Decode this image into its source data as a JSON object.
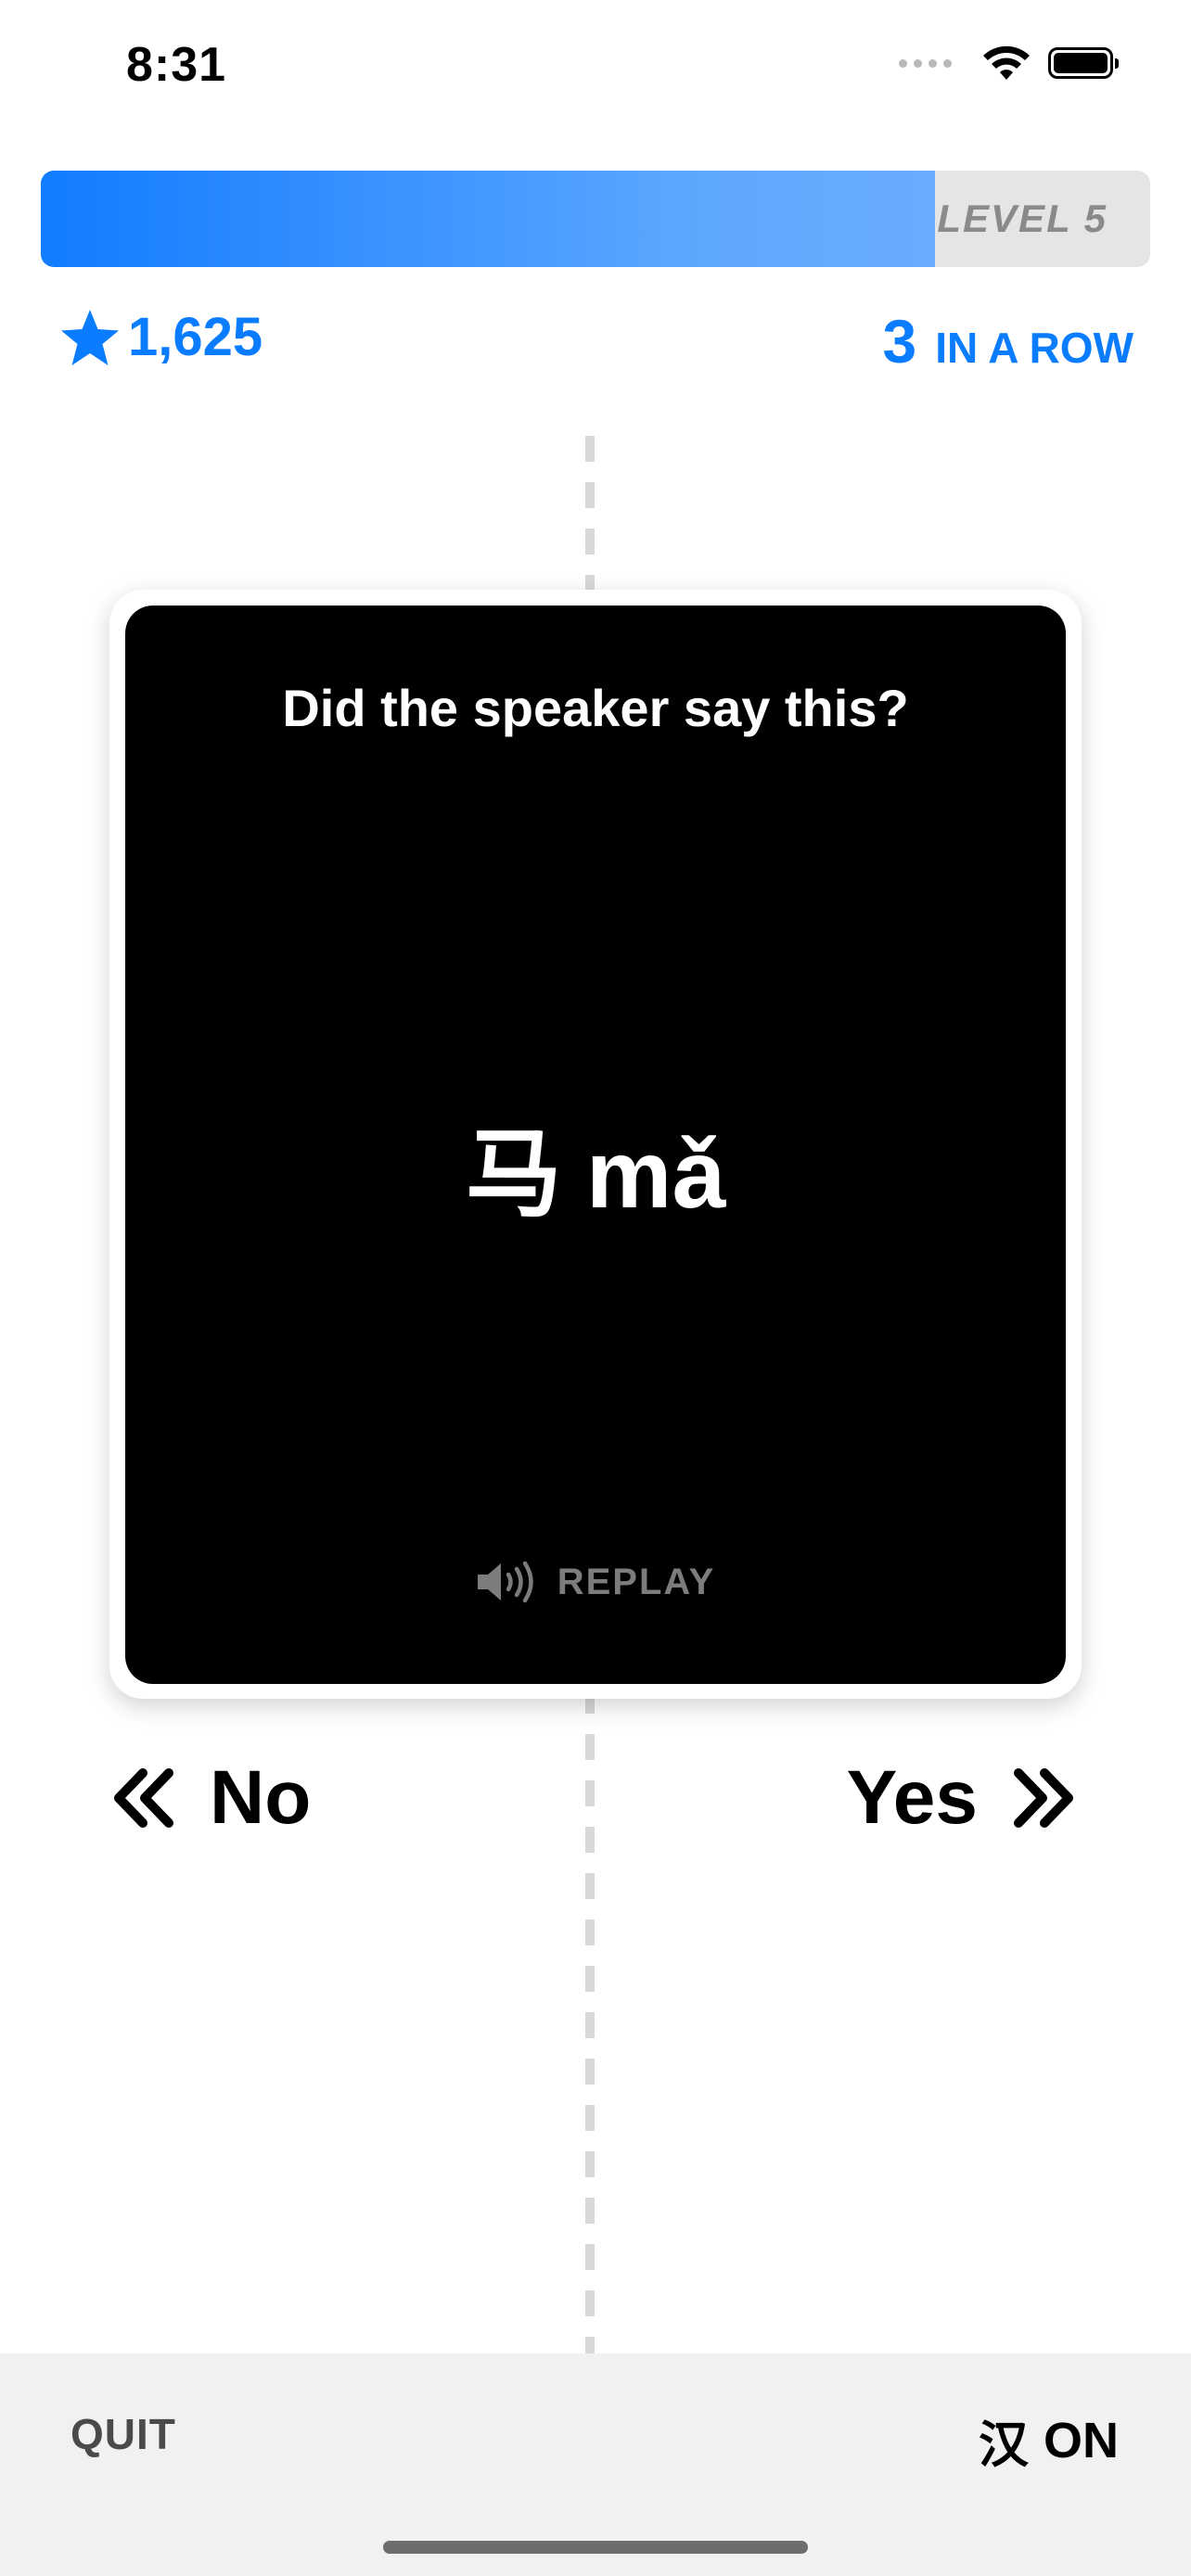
{
  "status_bar": {
    "time": "8:31"
  },
  "progress": {
    "fraction": 0.806,
    "level_label": "LEVEL 5",
    "fill_color": "#127cff"
  },
  "stats": {
    "score": "1,625",
    "score_icon": "star-icon",
    "streak_count": "3",
    "streak_label": "IN A ROW",
    "accent_color": "#0a7cff"
  },
  "card": {
    "prompt": "Did the speaker say this?",
    "hanzi": "马",
    "pinyin": "mǎ",
    "replay_label": "REPLAY",
    "replay_icon": "speaker-icon"
  },
  "choices": {
    "no_label": "No",
    "no_icon": "double-chevron-left-icon",
    "yes_label": "Yes",
    "yes_icon": "double-chevron-right-icon"
  },
  "bottom_bar": {
    "quit_label": "QUIT",
    "hanzi_glyph": "汉",
    "hanzi_toggle_state": "ON"
  }
}
